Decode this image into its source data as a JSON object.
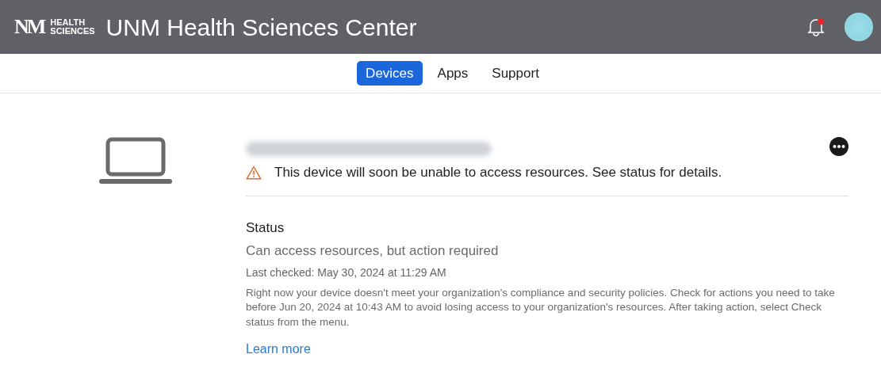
{
  "header": {
    "logo_mark": "NM",
    "logo_words": [
      "HEALTH",
      "SCIENCES"
    ],
    "title": "UNM Health Sciences Center",
    "notification_unread": true
  },
  "tabs": [
    {
      "label": "Devices",
      "selected": true
    },
    {
      "label": "Apps",
      "selected": false
    },
    {
      "label": "Support",
      "selected": false
    }
  ],
  "device": {
    "warning": "This device will soon be unable to access resources. See status for details."
  },
  "status": {
    "heading": "Status",
    "summary": "Can access resources, but action required",
    "last_checked": "Last checked: May 30, 2024 at 11:29 AM",
    "details": "Right now your device doesn't meet your organization's compliance and security policies. Check for actions you need to take before Jun 20, 2024 at 10:43 AM to avoid losing access to your organization's resources. After taking action, select Check status from the menu.",
    "link": "Learn more"
  }
}
